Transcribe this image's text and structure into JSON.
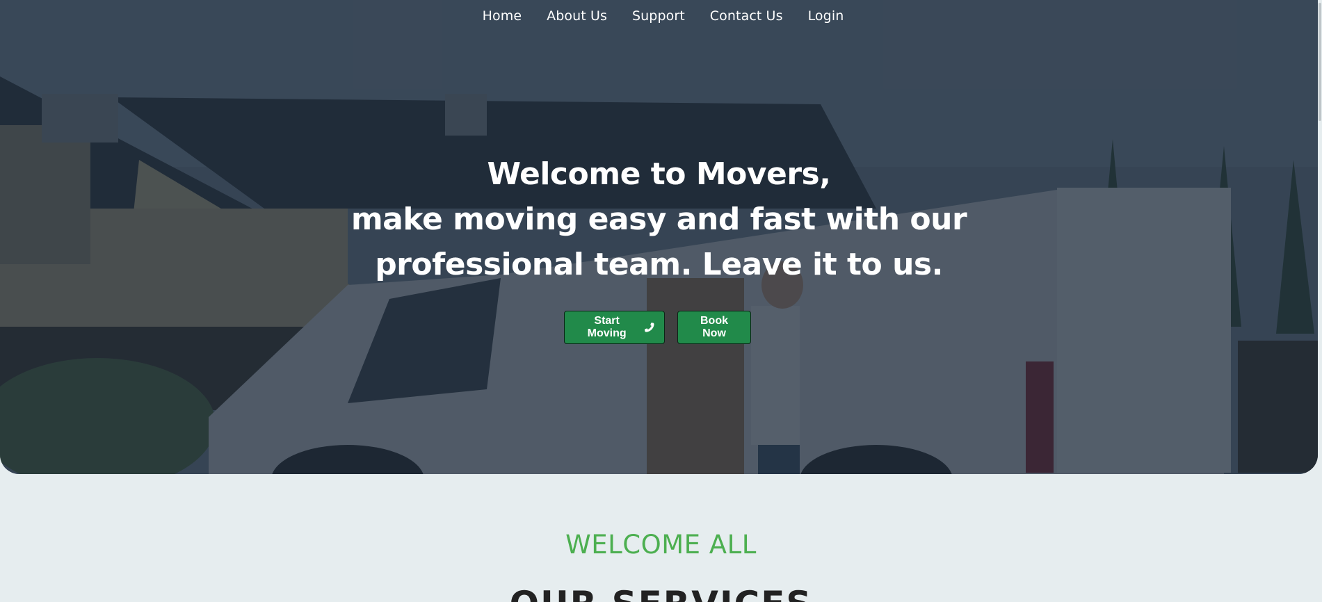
{
  "nav": {
    "items": [
      {
        "label": "Home"
      },
      {
        "label": "About Us"
      },
      {
        "label": "Support"
      },
      {
        "label": "Contact Us"
      },
      {
        "label": "Login"
      }
    ]
  },
  "hero": {
    "title_lines": [
      "Welcome to Movers,",
      "make moving easy and fast with our",
      "professional team. Leave it to us."
    ],
    "start_button": "Start Moving",
    "book_button": "Book Now"
  },
  "services": {
    "kicker": "WELCOME ALL",
    "title": "OUR SERVICES"
  },
  "colors": {
    "accent_green": "#218a4a",
    "kicker_green": "#4caf50",
    "hero_overlay": "#1c2a3a",
    "page_background": "#e6edef"
  },
  "icons": {
    "phone": "phone-icon"
  }
}
